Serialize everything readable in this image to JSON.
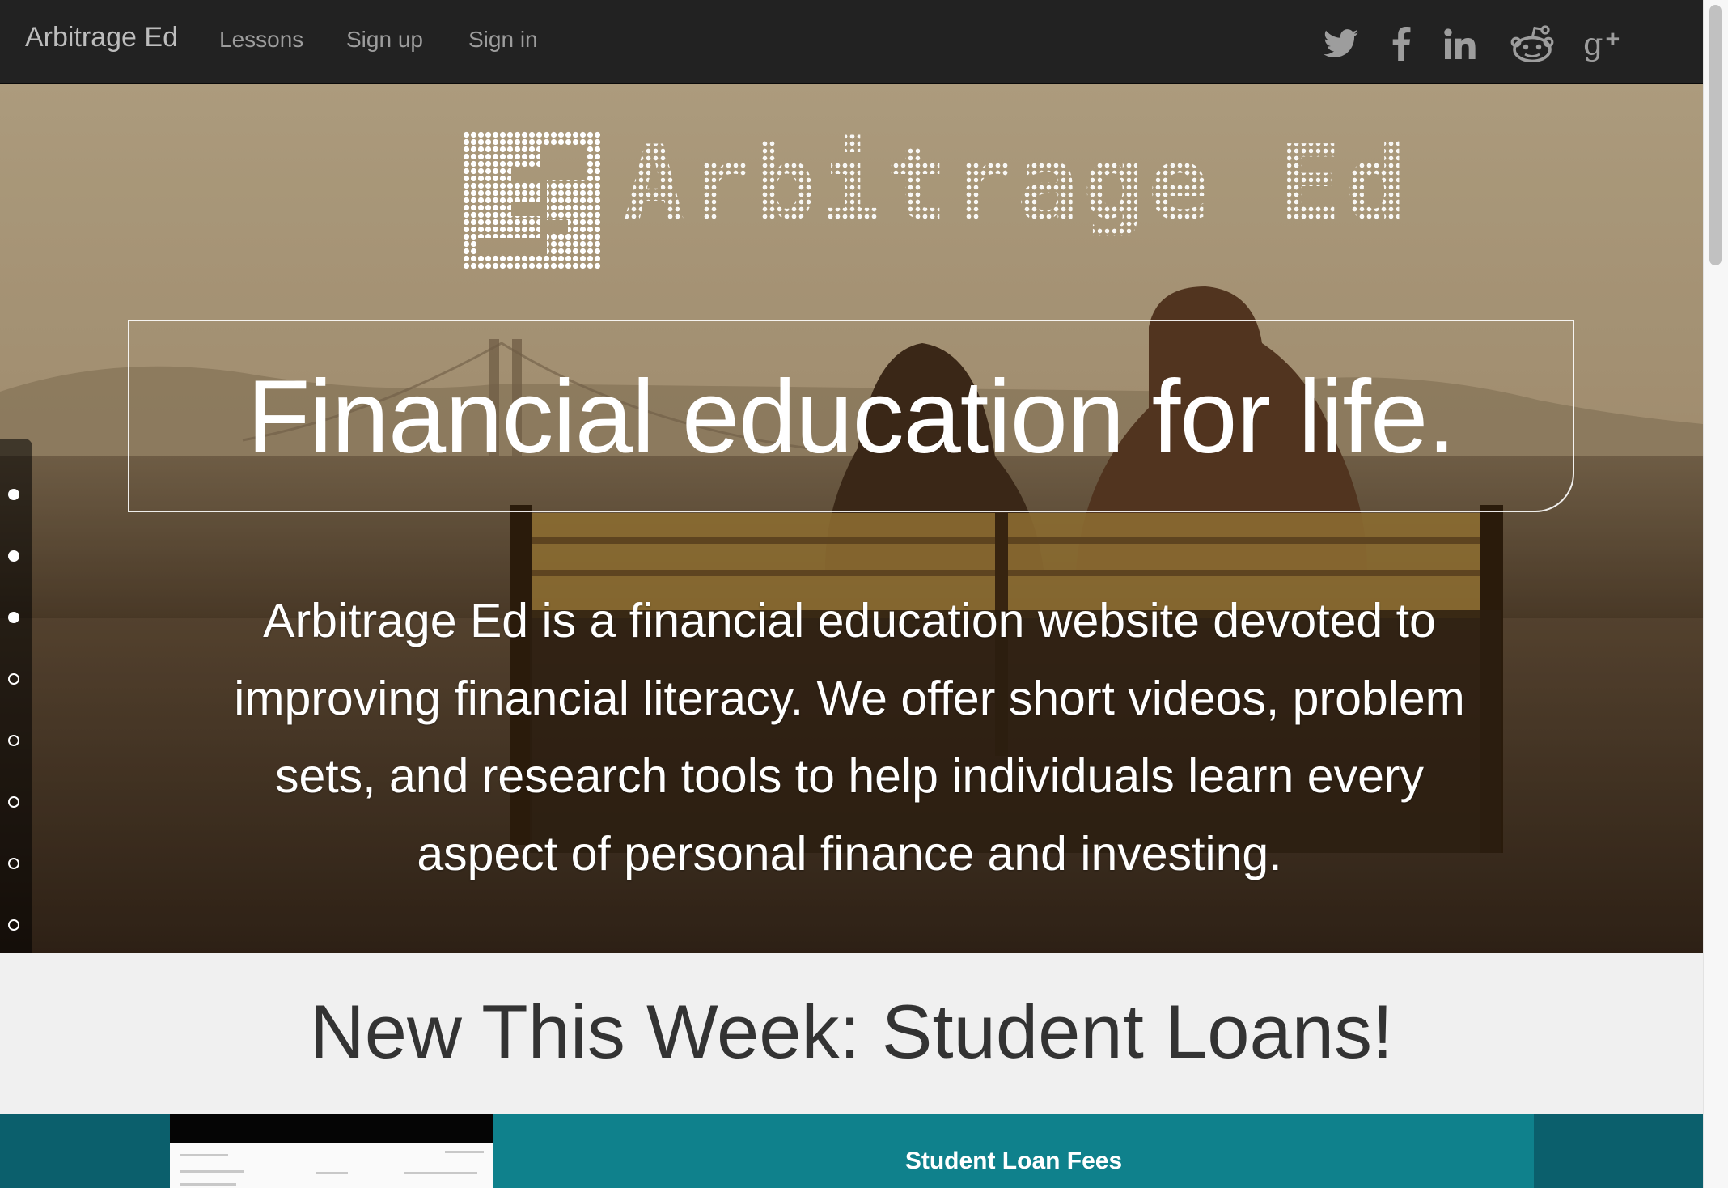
{
  "nav": {
    "brand": "Arbitrage Ed",
    "links": [
      "Lessons",
      "Sign up",
      "Sign in"
    ],
    "social": [
      "twitter-icon",
      "facebook-icon",
      "linkedin-icon",
      "reddit-icon",
      "google-plus-icon"
    ]
  },
  "hero": {
    "logo_text": "Arbitrage Ed",
    "tagline": "Financial education for life.",
    "intro": "Arbitrage Ed is a financial education website devoted to improving financial literacy. We offer short videos, problem sets, and research tools to help individuals learn every aspect of personal finance and investing.",
    "dots": [
      {
        "state": "active"
      },
      {
        "state": "active"
      },
      {
        "state": "active"
      },
      {
        "state": "inactive"
      },
      {
        "state": "inactive"
      },
      {
        "state": "inactive"
      },
      {
        "state": "inactive"
      },
      {
        "state": "inactive"
      }
    ]
  },
  "new_section": {
    "heading": "New This Week: Student Loans!"
  },
  "feature": {
    "title": "Student Loan Fees"
  },
  "colors": {
    "navbar": "#222222",
    "nav_text": "#9d9d9d",
    "teal_dark": "#0b5f6c",
    "teal": "#0f818c",
    "section_bg": "#f0f0f0"
  }
}
